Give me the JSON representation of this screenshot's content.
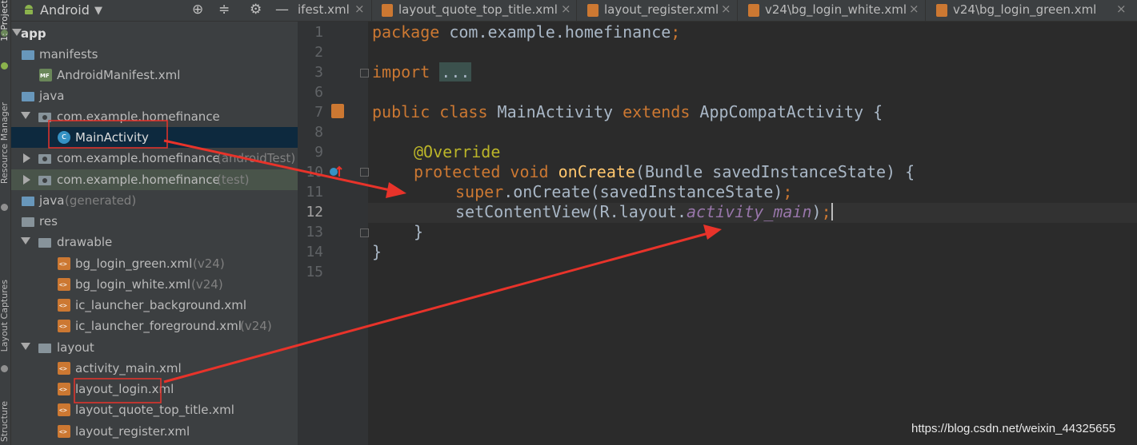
{
  "tool_window_tabs": [
    "1: Project",
    "Resource Manager",
    "Layout Captures",
    "Structure"
  ],
  "project_panel": {
    "view_mode": "Android",
    "actions": [
      "target-icon",
      "collapse-icon",
      "gear-icon",
      "minimize-icon"
    ],
    "tree": [
      {
        "label": "app",
        "suffix": "",
        "icon": "app-icon"
      },
      {
        "label": "manifests",
        "suffix": "",
        "icon": "folder-icon"
      },
      {
        "label": "AndroidManifest.xml",
        "suffix": "",
        "icon": "manifest-icon"
      },
      {
        "label": "java",
        "suffix": "",
        "icon": "folder-icon"
      },
      {
        "label": "com.example.homefinance",
        "suffix": "",
        "icon": "package-icon"
      },
      {
        "label": "MainActivity",
        "suffix": "",
        "icon": "class-icon"
      },
      {
        "label": "com.example.homefinance",
        "suffix": "(androidTest)",
        "icon": "package-icon"
      },
      {
        "label": "com.example.homefinance",
        "suffix": "(test)",
        "icon": "package-icon"
      },
      {
        "label": "java",
        "suffix": "(generated)",
        "icon": "folder-icon"
      },
      {
        "label": "res",
        "suffix": "",
        "icon": "folder-icon"
      },
      {
        "label": "drawable",
        "suffix": "",
        "icon": "folder-icon"
      },
      {
        "label": "bg_login_green.xml",
        "suffix": "(v24)",
        "icon": "xml-icon"
      },
      {
        "label": "bg_login_white.xml",
        "suffix": "(v24)",
        "icon": "xml-icon"
      },
      {
        "label": "ic_launcher_background.xml",
        "suffix": "",
        "icon": "xml-icon"
      },
      {
        "label": "ic_launcher_foreground.xml",
        "suffix": "(v24)",
        "icon": "xml-icon"
      },
      {
        "label": "layout",
        "suffix": "",
        "icon": "folder-icon"
      },
      {
        "label": "activity_main.xml",
        "suffix": "",
        "icon": "xml-icon"
      },
      {
        "label": "layout_login.xml",
        "suffix": "",
        "icon": "xml-icon"
      },
      {
        "label": "layout_quote_top_title.xml",
        "suffix": "",
        "icon": "xml-icon"
      },
      {
        "label": "layout_register.xml",
        "suffix": "",
        "icon": "xml-icon"
      }
    ]
  },
  "editor_tabs": [
    {
      "label": "ifest.xml"
    },
    {
      "label": "layout_quote_top_title.xml"
    },
    {
      "label": "layout_register.xml"
    },
    {
      "label": "v24\\bg_login_white.xml"
    },
    {
      "label": "v24\\bg_login_green.xml"
    }
  ],
  "tab_close_glyph": "×",
  "editor": {
    "line_numbers": [
      "1",
      "2",
      "3",
      "6",
      "7",
      "8",
      "9",
      "10",
      "11",
      "12",
      "13",
      "14",
      "15"
    ],
    "current_line": "12",
    "lines": {
      "l1_kw": "package",
      "l1_rest": " com.example.homefinance",
      "l1_semi": ";",
      "l3_kw": "import",
      "l3_fold": "...",
      "l7_kw1": "public class",
      "l7_name": " MainActivity ",
      "l7_kw2": "extends",
      "l7_rest": " AppCompatActivity {",
      "l9_ann": "@Override",
      "l10_kw": "protected void",
      "l10_fn": " onCreate",
      "l10_rest": "(Bundle savedInstanceState) {",
      "l11_kw": "super",
      "l11_rest": ".onCreate(savedInstanceState)",
      "l11_semi": ";",
      "l12_a": "setContentView(R.layout.",
      "l12_field": "activity_main",
      "l12_b": ")",
      "l12_semi": ";",
      "l13": "}",
      "l14": "}"
    }
  },
  "watermark": "https://blog.csdn.net/weixin_44325655",
  "colors": {
    "keyword": "#cc7832",
    "annotation": "#bbb529",
    "function": "#ffc66d",
    "field": "#9876aa",
    "annotation_arrow": "#e8332a"
  }
}
